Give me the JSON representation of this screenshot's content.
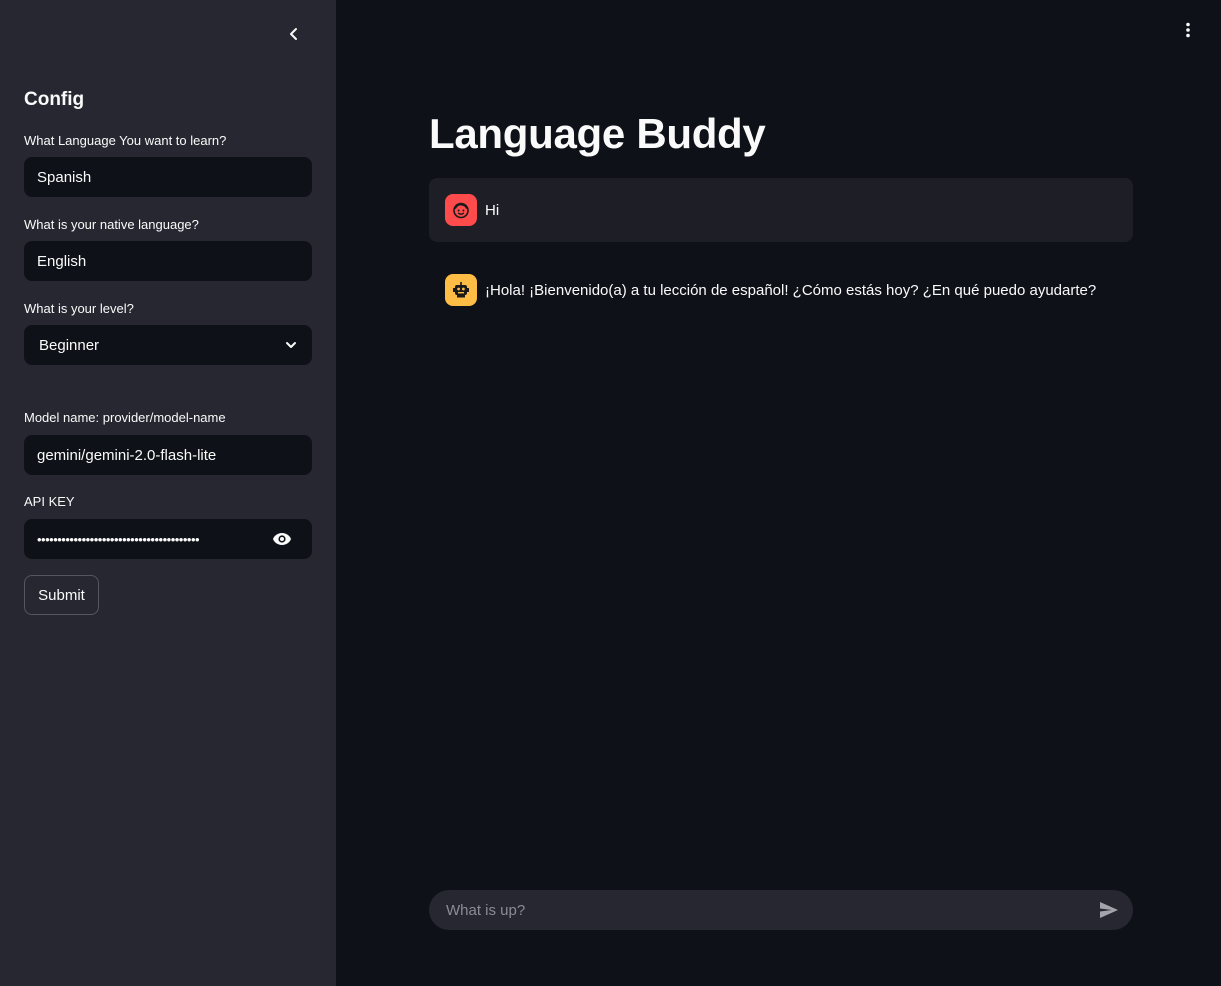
{
  "sidebar": {
    "title": "Config",
    "fields": {
      "target_language": {
        "label": "What Language You want to learn?",
        "value": "Spanish"
      },
      "native_language": {
        "label": "What is your native language?",
        "value": "English"
      },
      "level": {
        "label": "What is your level?",
        "value": "Beginner"
      },
      "model_name": {
        "label": "Model name: provider/model-name",
        "value": "gemini/gemini-2.0-flash-lite"
      },
      "api_key": {
        "label": "API KEY",
        "value": "••••••••••••••••••••••••••••••••••••••••"
      }
    },
    "submit_label": "Submit"
  },
  "main": {
    "title": "Language Buddy",
    "messages": [
      {
        "role": "user",
        "avatar_icon": "face-icon",
        "text": "Hi"
      },
      {
        "role": "assistant",
        "avatar_icon": "robot-icon",
        "text": "¡Hola! ¡Bienvenido(a) a tu lección de español! ¿Cómo estás hoy? ¿En qué puedo ayudarte?"
      }
    ],
    "chat_input": {
      "placeholder": "What is up?"
    }
  },
  "colors": {
    "sidebar_bg": "#262730",
    "main_bg": "#0e1117",
    "user_avatar": "#ff4b4b",
    "bot_avatar": "#ffbd45"
  }
}
